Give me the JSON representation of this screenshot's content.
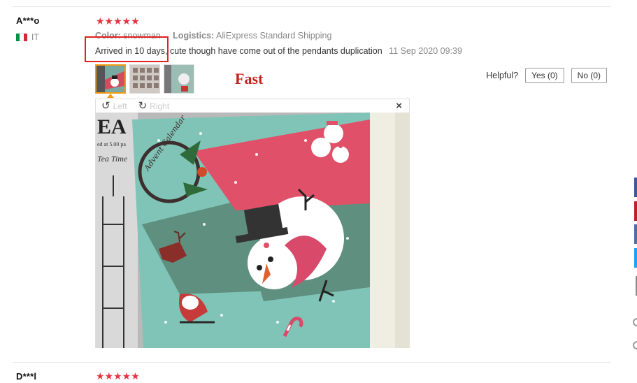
{
  "review1": {
    "user": "A***o",
    "country": "IT",
    "stars": "★★★★★",
    "color_label": "Color:",
    "color_value": "snowman",
    "logistics_label": "Logistics:",
    "logistics_value": "AliExpress Standard Shipping",
    "text": "Arrived in 10 days, cute though have come out of the pendants duplication",
    "date": "11 Sep 2020 09:39",
    "helpful_label": "Helpful?",
    "yes_label": "Yes (0)",
    "no_label": "No (0)"
  },
  "annotation": {
    "text": "Fast",
    "color": "#e0211f"
  },
  "viewer": {
    "rotate_left_icon": "↺",
    "left_label": "Left",
    "rotate_right_icon": "↻",
    "right_label": "Right",
    "close_icon": "×"
  },
  "photo_text": {
    "advent": "Advent Calendar",
    "bg_text_1": "EA",
    "bg_text_2": "ed at 5.00 pa",
    "bg_text_3": "Tea Time"
  },
  "review2": {
    "user": "D***l",
    "stars": "★★★★★"
  },
  "colors": {
    "star": "#e5343f",
    "accent_orange": "#f39c12",
    "flag_green": "#009246",
    "flag_white": "#ffffff",
    "flag_red": "#ce2b37"
  }
}
